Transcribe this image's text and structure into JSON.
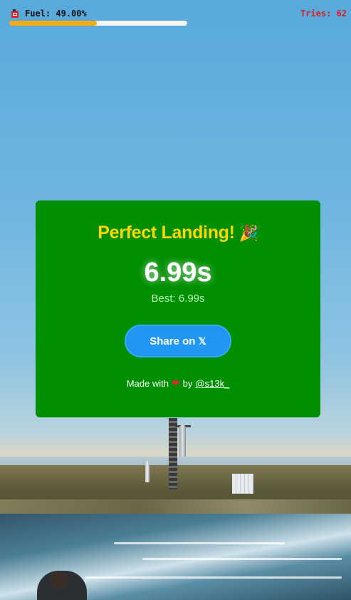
{
  "hud": {
    "fuel_icon": "fuel-can-icon",
    "fuel_label": "Fuel: 49.00%",
    "fuel_percent": 49,
    "fuel_color": "#f2ad14",
    "tries_label": "Tries: 62"
  },
  "result": {
    "title": "Perfect Landing!",
    "title_icon": "party-popper-icon",
    "time": "6.99s",
    "best": "Best: 6.99s",
    "share_label": "Share on",
    "share_icon": "x-logo-icon",
    "share_glyph": "𝕏",
    "credit_prefix": "Made with",
    "credit_icon": "heart-icon",
    "credit_by": "by",
    "credit_handle": "@s13k_"
  },
  "colors": {
    "modal_bg": "#008f00",
    "title": "#ffd600",
    "share_button": "#2196f3",
    "tries": "#e01b24"
  }
}
